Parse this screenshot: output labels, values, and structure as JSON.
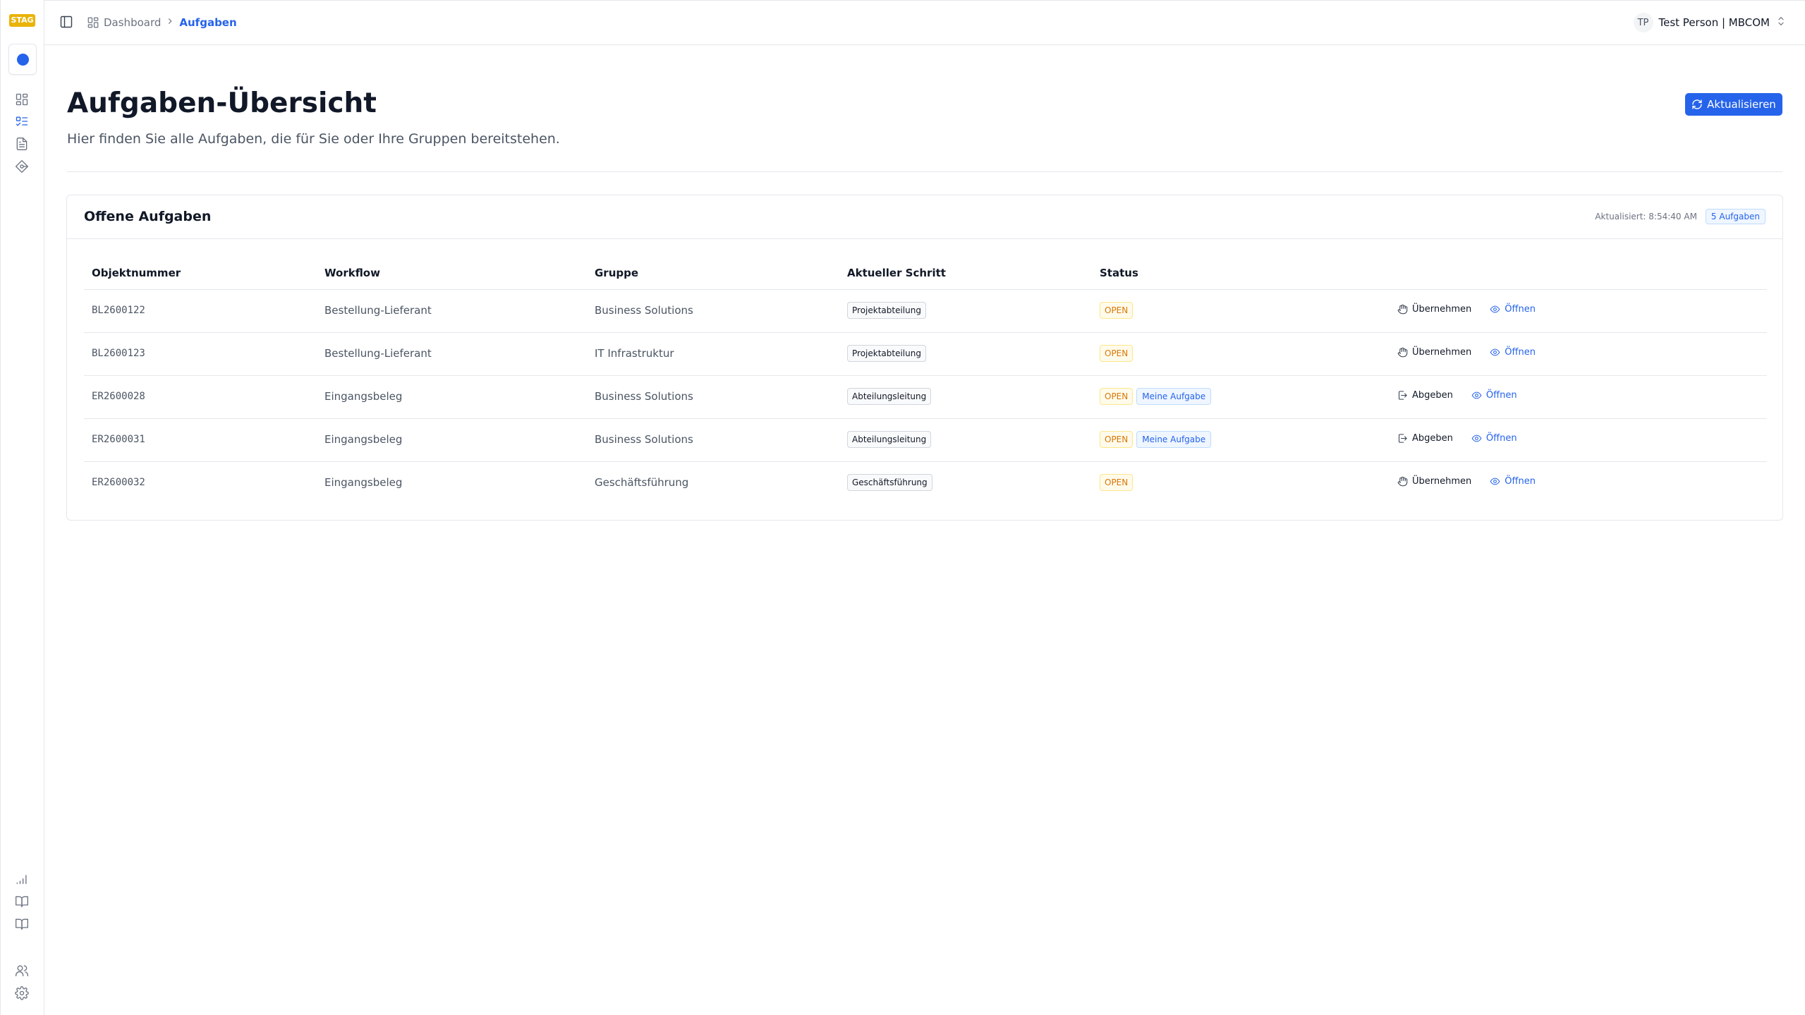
{
  "env": {
    "badge": "STAG"
  },
  "sidebar": {
    "top_items": [
      {
        "icon": "dashboard-grid-icon"
      },
      {
        "icon": "task-list-icon",
        "active": true
      },
      {
        "icon": "document-icon"
      },
      {
        "icon": "workflow-diamond-icon"
      }
    ],
    "bottom_items": [
      {
        "icon": "signal-bars-icon"
      },
      {
        "icon": "book-open-icon"
      },
      {
        "icon": "book-open-alt-icon"
      },
      {
        "icon": "users-icon"
      },
      {
        "icon": "settings-gear-icon"
      }
    ]
  },
  "header": {
    "breadcrumb": {
      "home": "Dashboard",
      "current": "Aufgaben"
    },
    "user": {
      "initials": "TP",
      "name": "Test Person | MBCOM"
    }
  },
  "page": {
    "title": "Aufgaben-Übersicht",
    "subtitle": "Hier finden Sie alle Aufgaben, die für Sie oder Ihre Gruppen bereitstehen.",
    "refresh_label": "Aktualisieren"
  },
  "card": {
    "title": "Offene Aufgaben",
    "updated": "Aktualisiert: 8:54:40 AM",
    "count": "5 Aufgaben",
    "columns": [
      "Objektnummer",
      "Workflow",
      "Gruppe",
      "Aktueller Schritt",
      "Status"
    ],
    "rows": [
      {
        "id": "BL2600122",
        "workflow": "Bestellung-Lieferant",
        "group": "Business Solutions",
        "step": "Projektabteilung",
        "status": "OPEN",
        "mine": "",
        "action": "Übernehmen",
        "open": "Öffnen"
      },
      {
        "id": "BL2600123",
        "workflow": "Bestellung-Lieferant",
        "group": "IT Infrastruktur",
        "step": "Projektabteilung",
        "status": "OPEN",
        "mine": "",
        "action": "Übernehmen",
        "open": "Öffnen"
      },
      {
        "id": "ER2600028",
        "workflow": "Eingangsbeleg",
        "group": "Business Solutions",
        "step": "Abteilungsleitung",
        "status": "OPEN",
        "mine": "Meine Aufgabe",
        "action": "Abgeben",
        "open": "Öffnen"
      },
      {
        "id": "ER2600031",
        "workflow": "Eingangsbeleg",
        "group": "Business Solutions",
        "step": "Abteilungsleitung",
        "status": "OPEN",
        "mine": "Meine Aufgabe",
        "action": "Abgeben",
        "open": "Öffnen"
      },
      {
        "id": "ER2600032",
        "workflow": "Eingangsbeleg",
        "group": "Geschäftsführung",
        "step": "Geschäftsführung",
        "status": "OPEN",
        "mine": "",
        "action": "Übernehmen",
        "open": "Öffnen"
      }
    ]
  },
  "colors": {
    "accent": "#2563eb",
    "env_badge": "#eab308",
    "open_status": "#d97706"
  }
}
